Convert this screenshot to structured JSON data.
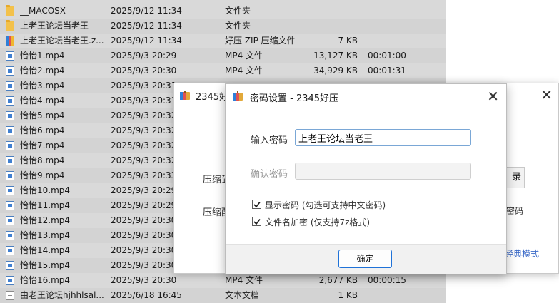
{
  "files": [
    {
      "icon": "folder-icon",
      "name": "__MACOSX",
      "date": "2025/9/12 11:34",
      "type": "文件夹",
      "size": "",
      "duration": ""
    },
    {
      "icon": "folder-icon",
      "name": "上老王论坛当老王",
      "date": "2025/9/12 11:34",
      "type": "文件夹",
      "size": "",
      "duration": ""
    },
    {
      "icon": "zip-icon",
      "name": "上老王论坛当老王.z...",
      "date": "2025/9/12 11:34",
      "type": "好压 ZIP 压缩文件",
      "size": "7 KB",
      "duration": ""
    },
    {
      "icon": "video-file-icon",
      "name": "怡怡1.mp4",
      "date": "2025/9/3 20:29",
      "type": "MP4 文件",
      "size": "13,127 KB",
      "duration": "00:01:00"
    },
    {
      "icon": "video-file-icon",
      "name": "怡怡2.mp4",
      "date": "2025/9/3 20:30",
      "type": "MP4 文件",
      "size": "34,929 KB",
      "duration": "00:01:31"
    },
    {
      "icon": "video-file-icon",
      "name": "怡怡3.mp4",
      "date": "2025/9/3 20:31",
      "type": "",
      "size": "",
      "duration": ""
    },
    {
      "icon": "video-file-icon",
      "name": "怡怡4.mp4",
      "date": "2025/9/3 20:31",
      "type": "",
      "size": "",
      "duration": ""
    },
    {
      "icon": "video-file-icon",
      "name": "怡怡5.mp4",
      "date": "2025/9/3 20:32",
      "type": "",
      "size": "",
      "duration": ""
    },
    {
      "icon": "video-file-icon",
      "name": "怡怡6.mp4",
      "date": "2025/9/3 20:32",
      "type": "",
      "size": "",
      "duration": ""
    },
    {
      "icon": "video-file-icon",
      "name": "怡怡7.mp4",
      "date": "2025/9/3 20:32",
      "type": "",
      "size": "",
      "duration": ""
    },
    {
      "icon": "video-file-icon",
      "name": "怡怡8.mp4",
      "date": "2025/9/3 20:32",
      "type": "",
      "size": "",
      "duration": ""
    },
    {
      "icon": "video-file-icon",
      "name": "怡怡9.mp4",
      "date": "2025/9/3 20:33",
      "type": "",
      "size": "",
      "duration": ""
    },
    {
      "icon": "video-file-icon",
      "name": "怡怡10.mp4",
      "date": "2025/9/3 20:29",
      "type": "",
      "size": "",
      "duration": ""
    },
    {
      "icon": "video-file-icon",
      "name": "怡怡11.mp4",
      "date": "2025/9/3 20:29",
      "type": "",
      "size": "",
      "duration": ""
    },
    {
      "icon": "video-file-icon",
      "name": "怡怡12.mp4",
      "date": "2025/9/3 20:30",
      "type": "",
      "size": "",
      "duration": ""
    },
    {
      "icon": "video-file-icon",
      "name": "怡怡13.mp4",
      "date": "2025/9/3 20:30",
      "type": "",
      "size": "",
      "duration": ""
    },
    {
      "icon": "video-file-icon",
      "name": "怡怡14.mp4",
      "date": "2025/9/3 20:30",
      "type": "",
      "size": "",
      "duration": ""
    },
    {
      "icon": "video-file-icon",
      "name": "怡怡15.mp4",
      "date": "2025/9/3 20:30",
      "type": "",
      "size": "",
      "duration": ""
    },
    {
      "icon": "video-file-icon",
      "name": "怡怡16.mp4",
      "date": "2025/9/3 20:30",
      "type": "MP4 文件",
      "size": "2,677 KB",
      "duration": "00:00:15"
    },
    {
      "icon": "text-file-icon",
      "name": "由老王论坛hjhhlsal...",
      "date": "2025/6/18 16:45",
      "type": "文本文档",
      "size": "1 KB",
      "duration": ""
    }
  ],
  "back_window": {
    "title": "2345好",
    "label_1": "压缩到",
    "label_2": "压缩配",
    "button_fragment": "录",
    "right_text": "密码",
    "link": "经典模式",
    "close": "✕"
  },
  "dialog": {
    "title": "密码设置 - 2345好压",
    "close": "✕",
    "password_label": "输入密码",
    "password_value": "上老王论坛当老王",
    "confirm_label": "确认密码",
    "confirm_value": "",
    "show_password_label": "显示密码 (勾选可支持中文密码)",
    "show_password_checked": true,
    "encrypt_names_label": "文件名加密 (仅支持7z格式)",
    "encrypt_names_checked": true,
    "ok_label": "确定"
  },
  "colors": {
    "accent": "#1f72d8",
    "link": "#3c6bc8",
    "list_bg": "#d9d9d9"
  }
}
